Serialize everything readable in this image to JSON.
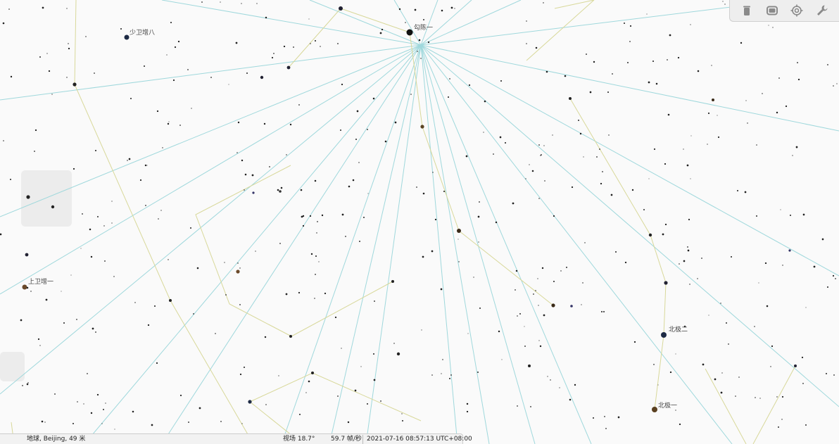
{
  "star_labels": [
    {
      "id": "star-gouchen-1",
      "text": "勾陈一"
    },
    {
      "id": "star-shaoweizeng-8",
      "text": "少卫增八"
    },
    {
      "id": "star-shangweizeng-1",
      "text": "上卫增一"
    },
    {
      "id": "star-beiji-2",
      "text": "北极二"
    },
    {
      "id": "star-beiji-1",
      "text": "北极一"
    }
  ],
  "toolbar": {
    "buttons": [
      {
        "name": "trash-icon"
      },
      {
        "name": "window-icon"
      },
      {
        "name": "target-icon"
      },
      {
        "name": "wrench-icon"
      }
    ]
  },
  "status_bar": {
    "location": "地球, Beijing, 49 米",
    "fov": "视场 18.7°",
    "fps": "59.7 帧/秒",
    "datetime": "2021-07-16 08:57:13 UTC+08:00"
  },
  "colors": {
    "background": "#fafafa",
    "meridian_lines": "#9fd8dc",
    "constellation_lines": "#d8d89a",
    "star": "#111111"
  }
}
